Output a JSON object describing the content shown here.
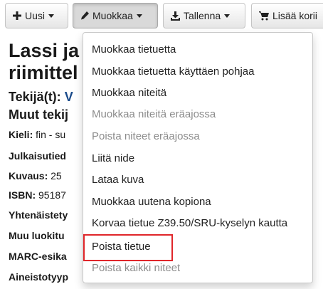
{
  "toolbar": {
    "new_label": "Uusi",
    "edit_label": "Muokkaa",
    "save_label": "Tallenna",
    "add_cart_label": "Lisää korii"
  },
  "record": {
    "title_line1": "Lassi ja",
    "title_line2": "riimittel",
    "author_label": "Tekijä(t):",
    "author_value": "V",
    "other_authors_heading": "Muut tekij",
    "fields": [
      {
        "label": "Kieli:",
        "value": " fin - su"
      },
      {
        "label": "Julkaisutied",
        "value": ""
      },
      {
        "label": "Kuvaus:",
        "value": " 25"
      },
      {
        "label": "ISBN:",
        "value": " 95187"
      },
      {
        "label": "Yhtenäistety",
        "value": ""
      },
      {
        "label": "Muu luokitu",
        "value": ""
      },
      {
        "label": "MARC-esika",
        "value": ""
      },
      {
        "label": "Aineistotyyp",
        "value": ""
      }
    ]
  },
  "edit_menu": {
    "items": [
      {
        "label": "Muokkaa tietuetta",
        "disabled": false
      },
      {
        "label": "Muokkaa tietuetta käyttäen pohjaa",
        "disabled": false
      },
      {
        "label": "Muokkaa niteitä",
        "disabled": false
      },
      {
        "label": "Muokkaa niteitä eräajossa",
        "disabled": true
      },
      {
        "label": "Poista niteet eräajossa",
        "disabled": true
      },
      {
        "label": "Liitä nide",
        "disabled": false
      },
      {
        "label": "Lataa kuva",
        "disabled": false
      },
      {
        "label": "Muokkaa uutena kopiona",
        "disabled": false
      },
      {
        "label": "Korvaa tietue Z39.50/SRU-kyselyn kautta",
        "disabled": false
      },
      {
        "label": "Poista tietue",
        "disabled": false,
        "highlighted": true
      },
      {
        "label": "Poista kaikki niteet",
        "disabled": true
      }
    ]
  },
  "colors": {
    "highlight_border": "#e0262a",
    "disabled_text": "#8c8c8c",
    "author_link": "#1a4a8a"
  }
}
